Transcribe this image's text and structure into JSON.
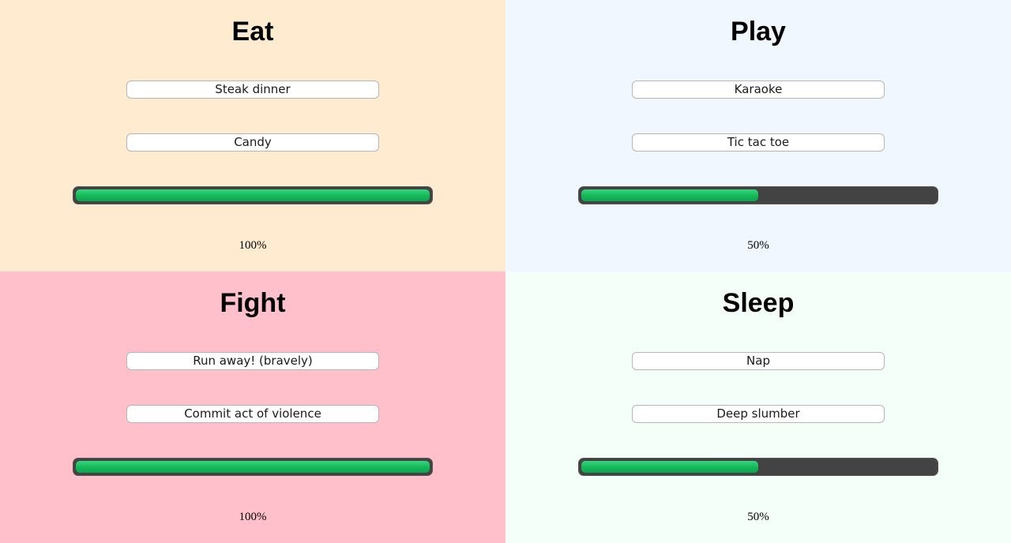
{
  "panels": [
    {
      "title": "Eat",
      "background": "#ffebd0",
      "options": [
        "Steak dinner",
        "Candy"
      ],
      "progress": 1.0,
      "progress_label": "100%"
    },
    {
      "title": "Play",
      "background": "#f0f7ff",
      "options": [
        "Karaoke",
        "Tic tac toe"
      ],
      "progress": 0.5,
      "progress_label": "50%"
    },
    {
      "title": "Fight",
      "background": "#ffbfcb",
      "options": [
        "Run away! (bravely)",
        "Commit act of violence"
      ],
      "progress": 1.0,
      "progress_label": "100%"
    },
    {
      "title": "Sleep",
      "background": "#f5fff9",
      "options": [
        "Nap",
        "Deep slumber"
      ],
      "progress": 0.5,
      "progress_label": "50%"
    }
  ],
  "colors": {
    "progress_fill": "#14b85a",
    "progress_track": "#434343"
  }
}
